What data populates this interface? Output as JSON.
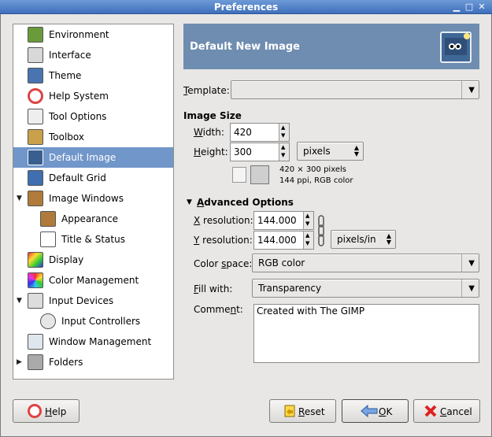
{
  "window": {
    "title": "Preferences"
  },
  "sidebar": {
    "items": [
      {
        "label": "Environment"
      },
      {
        "label": "Interface"
      },
      {
        "label": "Theme"
      },
      {
        "label": "Help System"
      },
      {
        "label": "Tool Options"
      },
      {
        "label": "Toolbox"
      },
      {
        "label": "Default Image"
      },
      {
        "label": "Default Grid"
      },
      {
        "label": "Image Windows"
      },
      {
        "label": "Appearance"
      },
      {
        "label": "Title & Status"
      },
      {
        "label": "Display"
      },
      {
        "label": "Color Management"
      },
      {
        "label": "Input Devices"
      },
      {
        "label": "Input Controllers"
      },
      {
        "label": "Window Management"
      },
      {
        "label": "Folders"
      }
    ]
  },
  "header": {
    "title": "Default New Image"
  },
  "template": {
    "label_u": "T",
    "label_rest": "emplate:",
    "value": ""
  },
  "image_size": {
    "heading": "Image Size",
    "width_u": "W",
    "width_rest": "idth:",
    "width_value": "420",
    "height_u": "H",
    "height_rest": "eight:",
    "height_value": "300",
    "unit": "pixels",
    "info_line1": "420 × 300 pixels",
    "info_line2": "144 ppi, RGB color"
  },
  "advanced": {
    "heading_u": "A",
    "heading_rest": "dvanced Options",
    "xres_u": "X",
    "xres_rest": " resolution:",
    "xres_value": "144.000",
    "yres_u": "Y",
    "yres_rest": " resolution:",
    "yres_value": "144.000",
    "res_unit": "pixels/in",
    "colorspace_pre": "Color ",
    "colorspace_u": "s",
    "colorspace_rest": "pace:",
    "colorspace_value": "RGB color",
    "fill_u": "F",
    "fill_rest": "ill with:",
    "fill_value": "Transparency",
    "comment_pre": "Comme",
    "comment_u": "n",
    "comment_rest": "t:",
    "comment_value": "Created with The GIMP"
  },
  "buttons": {
    "help_u": "H",
    "help_rest": "elp",
    "reset_u": "R",
    "reset_rest": "eset",
    "ok_u": "O",
    "ok_rest": "K",
    "cancel_u": "C",
    "cancel_rest": "ancel"
  }
}
